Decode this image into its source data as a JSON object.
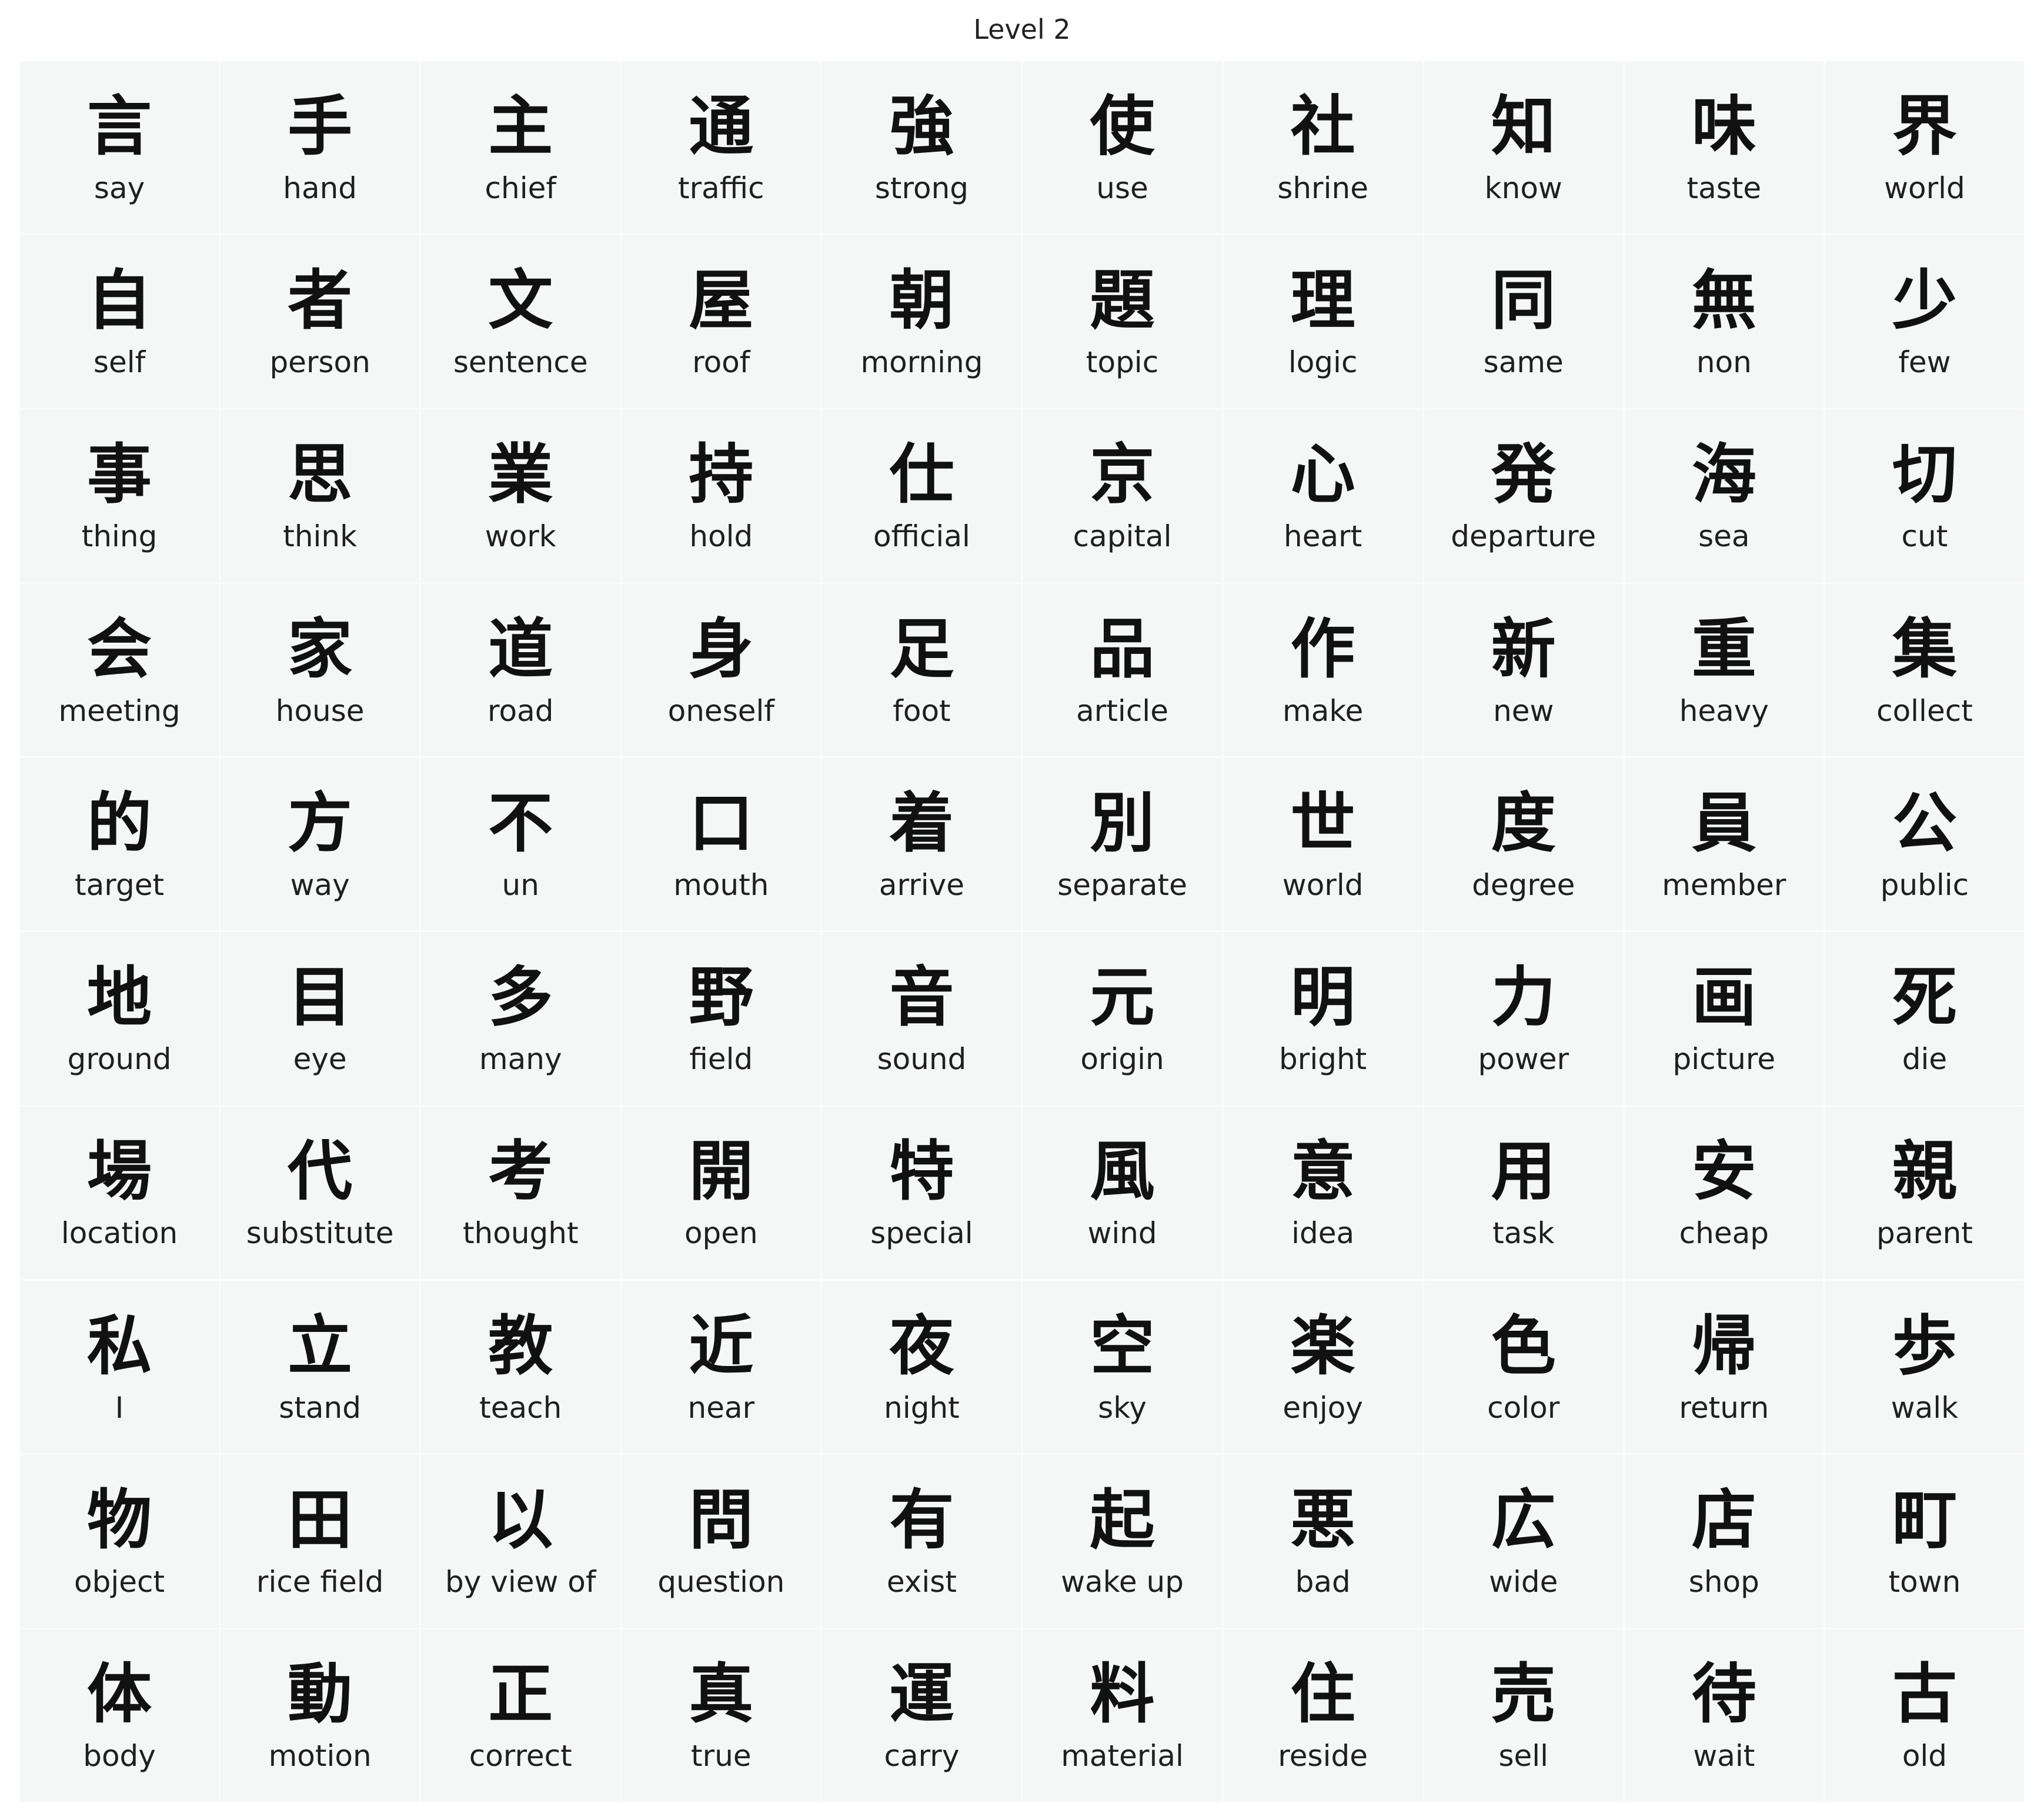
{
  "title": "Level 2",
  "cards": [
    {
      "kanji": "言",
      "meaning": "say"
    },
    {
      "kanji": "手",
      "meaning": "hand"
    },
    {
      "kanji": "主",
      "meaning": "chief"
    },
    {
      "kanji": "通",
      "meaning": "traffic"
    },
    {
      "kanji": "強",
      "meaning": "strong"
    },
    {
      "kanji": "使",
      "meaning": "use"
    },
    {
      "kanji": "社",
      "meaning": "shrine"
    },
    {
      "kanji": "知",
      "meaning": "know"
    },
    {
      "kanji": "味",
      "meaning": "taste"
    },
    {
      "kanji": "界",
      "meaning": "world"
    },
    {
      "kanji": "自",
      "meaning": "self"
    },
    {
      "kanji": "者",
      "meaning": "person"
    },
    {
      "kanji": "文",
      "meaning": "sentence"
    },
    {
      "kanji": "屋",
      "meaning": "roof"
    },
    {
      "kanji": "朝",
      "meaning": "morning"
    },
    {
      "kanji": "題",
      "meaning": "topic"
    },
    {
      "kanji": "理",
      "meaning": "logic"
    },
    {
      "kanji": "同",
      "meaning": "same"
    },
    {
      "kanji": "無",
      "meaning": "non"
    },
    {
      "kanji": "少",
      "meaning": "few"
    },
    {
      "kanji": "事",
      "meaning": "thing"
    },
    {
      "kanji": "思",
      "meaning": "think"
    },
    {
      "kanji": "業",
      "meaning": "work"
    },
    {
      "kanji": "持",
      "meaning": "hold"
    },
    {
      "kanji": "仕",
      "meaning": "official"
    },
    {
      "kanji": "京",
      "meaning": "capital"
    },
    {
      "kanji": "心",
      "meaning": "heart"
    },
    {
      "kanji": "発",
      "meaning": "departure"
    },
    {
      "kanji": "海",
      "meaning": "sea"
    },
    {
      "kanji": "切",
      "meaning": "cut"
    },
    {
      "kanji": "会",
      "meaning": "meeting"
    },
    {
      "kanji": "家",
      "meaning": "house"
    },
    {
      "kanji": "道",
      "meaning": "road"
    },
    {
      "kanji": "身",
      "meaning": "oneself"
    },
    {
      "kanji": "足",
      "meaning": "foot"
    },
    {
      "kanji": "品",
      "meaning": "article"
    },
    {
      "kanji": "作",
      "meaning": "make"
    },
    {
      "kanji": "新",
      "meaning": "new"
    },
    {
      "kanji": "重",
      "meaning": "heavy"
    },
    {
      "kanji": "集",
      "meaning": "collect"
    },
    {
      "kanji": "的",
      "meaning": "target"
    },
    {
      "kanji": "方",
      "meaning": "way"
    },
    {
      "kanji": "不",
      "meaning": "un"
    },
    {
      "kanji": "口",
      "meaning": "mouth"
    },
    {
      "kanji": "着",
      "meaning": "arrive"
    },
    {
      "kanji": "別",
      "meaning": "separate"
    },
    {
      "kanji": "世",
      "meaning": "world"
    },
    {
      "kanji": "度",
      "meaning": "degree"
    },
    {
      "kanji": "員",
      "meaning": "member"
    },
    {
      "kanji": "公",
      "meaning": "public"
    },
    {
      "kanji": "地",
      "meaning": "ground"
    },
    {
      "kanji": "目",
      "meaning": "eye"
    },
    {
      "kanji": "多",
      "meaning": "many"
    },
    {
      "kanji": "野",
      "meaning": "field"
    },
    {
      "kanji": "音",
      "meaning": "sound"
    },
    {
      "kanji": "元",
      "meaning": "origin"
    },
    {
      "kanji": "明",
      "meaning": "bright"
    },
    {
      "kanji": "力",
      "meaning": "power"
    },
    {
      "kanji": "画",
      "meaning": "picture"
    },
    {
      "kanji": "死",
      "meaning": "die"
    },
    {
      "kanji": "場",
      "meaning": "location"
    },
    {
      "kanji": "代",
      "meaning": "substitute"
    },
    {
      "kanji": "考",
      "meaning": "thought"
    },
    {
      "kanji": "開",
      "meaning": "open"
    },
    {
      "kanji": "特",
      "meaning": "special"
    },
    {
      "kanji": "風",
      "meaning": "wind"
    },
    {
      "kanji": "意",
      "meaning": "idea"
    },
    {
      "kanji": "用",
      "meaning": "task"
    },
    {
      "kanji": "安",
      "meaning": "cheap"
    },
    {
      "kanji": "親",
      "meaning": "parent"
    },
    {
      "kanji": "私",
      "meaning": "I"
    },
    {
      "kanji": "立",
      "meaning": "stand"
    },
    {
      "kanji": "教",
      "meaning": "teach"
    },
    {
      "kanji": "近",
      "meaning": "near"
    },
    {
      "kanji": "夜",
      "meaning": "night"
    },
    {
      "kanji": "空",
      "meaning": "sky"
    },
    {
      "kanji": "楽",
      "meaning": "enjoy"
    },
    {
      "kanji": "色",
      "meaning": "color"
    },
    {
      "kanji": "帰",
      "meaning": "return"
    },
    {
      "kanji": "歩",
      "meaning": "walk"
    },
    {
      "kanji": "物",
      "meaning": "object"
    },
    {
      "kanji": "田",
      "meaning": "rice field"
    },
    {
      "kanji": "以",
      "meaning": "by view of"
    },
    {
      "kanji": "問",
      "meaning": "question"
    },
    {
      "kanji": "有",
      "meaning": "exist"
    },
    {
      "kanji": "起",
      "meaning": "wake up"
    },
    {
      "kanji": "悪",
      "meaning": "bad"
    },
    {
      "kanji": "広",
      "meaning": "wide"
    },
    {
      "kanji": "店",
      "meaning": "shop"
    },
    {
      "kanji": "町",
      "meaning": "town"
    },
    {
      "kanji": "体",
      "meaning": "body"
    },
    {
      "kanji": "動",
      "meaning": "motion"
    },
    {
      "kanji": "正",
      "meaning": "correct"
    },
    {
      "kanji": "真",
      "meaning": "true"
    },
    {
      "kanji": "運",
      "meaning": "carry"
    },
    {
      "kanji": "料",
      "meaning": "material"
    },
    {
      "kanji": "住",
      "meaning": "reside"
    },
    {
      "kanji": "売",
      "meaning": "sell"
    },
    {
      "kanji": "待",
      "meaning": "wait"
    },
    {
      "kanji": "古",
      "meaning": "old"
    }
  ]
}
